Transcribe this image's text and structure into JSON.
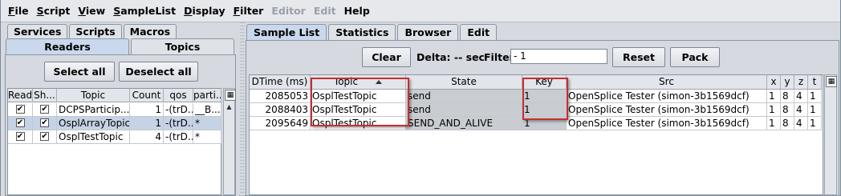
{
  "menubar": {
    "items": [
      {
        "label": "File",
        "underline": "F",
        "rest": "ile",
        "disabled": false
      },
      {
        "label": "Script",
        "underline": "S",
        "rest": "cript",
        "disabled": false
      },
      {
        "label": "View",
        "underline": "V",
        "rest": "iew",
        "disabled": false
      },
      {
        "label": "SampleList",
        "underline": "S",
        "rest": "ampleList",
        "disabled": false
      },
      {
        "label": "Display",
        "underline": "D",
        "rest": "isplay",
        "disabled": false
      },
      {
        "label": "Filter",
        "underline": "F",
        "rest": "ilter",
        "disabled": false
      },
      {
        "label": "Editor",
        "underline": "",
        "rest": "Editor",
        "disabled": true
      },
      {
        "label": "Edit",
        "underline": "",
        "rest": "Edit",
        "disabled": true
      },
      {
        "label": "Help",
        "underline": "",
        "rest": "Help",
        "disabled": false
      }
    ]
  },
  "left": {
    "tabs": [
      "Services",
      "Scripts",
      "Macros"
    ],
    "subtabs": {
      "active": "Readers",
      "inactive": "Topics"
    },
    "select_all": "Select all",
    "deselect_all": "Deselect all",
    "table": {
      "columns": [
        "Read",
        "Sh...",
        "Topic",
        "Count",
        "qos",
        "parti..."
      ],
      "rows": [
        {
          "read": "✔",
          "show": "✔",
          "topic": "DCPSParticip...",
          "count": "1",
          "qos": "-(trD...",
          "partition": "__B..."
        },
        {
          "read": "✔",
          "show": "✔",
          "topic": "OsplArrayTopic",
          "count": "1",
          "qos": "-(trD...",
          "partition": "*"
        },
        {
          "read": "✔",
          "show": "✔",
          "topic": "OsplTestTopic",
          "count": "4",
          "qos": "-(trD...",
          "partition": "*"
        }
      ]
    }
  },
  "right": {
    "tabs": [
      "Sample List",
      "Statistics",
      "Browser",
      "Edit"
    ],
    "clear": "Clear",
    "delta_label": "Delta: -- sec",
    "filter_label": "Filter",
    "filter_value": "- 1",
    "reset": "Reset",
    "pack": "Pack",
    "table": {
      "columns": [
        "DTime (ms)",
        "Topic",
        "State",
        "Key",
        "Src",
        "x",
        "y",
        "z",
        "t"
      ],
      "rows": [
        {
          "dtime": "2085053",
          "topic": "OsplTestTopic",
          "state": "send",
          "key": "1",
          "src": "OpenSplice Tester (simon-3b1569dcf)",
          "x": "1",
          "y": "8",
          "z": "4",
          "t": "1"
        },
        {
          "dtime": "2088403",
          "topic": "OsplTestTopic",
          "state": "send",
          "key": "1",
          "src": "OpenSplice Tester (simon-3b1569dcf)",
          "x": "1",
          "y": "8",
          "z": "4",
          "t": "1"
        },
        {
          "dtime": "2095649",
          "topic": "OsplTestTopic",
          "state": "SEND_AND_ALIVE",
          "key": "1",
          "src": "OpenSplice Tester (simon-3b1569dcf)",
          "x": "1",
          "y": "8",
          "z": "4",
          "t": "1"
        }
      ]
    }
  }
}
